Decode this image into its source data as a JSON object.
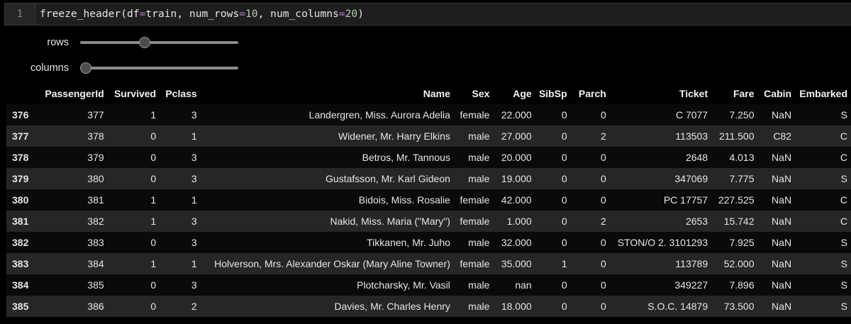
{
  "code_cell": {
    "line_number": "1",
    "func": "freeze_header(",
    "arg1_key": "df",
    "arg1_val": "train, ",
    "arg2_key": "num_rows",
    "arg2_val": "10",
    "arg3_key": "num_columns",
    "arg3_val": "20",
    "close": ")",
    "eq": "=",
    "comma": ", "
  },
  "widgets": {
    "rows": {
      "label": "rows",
      "level": 0.4
    },
    "columns": {
      "label": "columns",
      "level": 0.0
    }
  },
  "table": {
    "columns": [
      "",
      "PassengerId",
      "Survived",
      "Pclass",
      "Name",
      "Sex",
      "Age",
      "SibSp",
      "Parch",
      "Ticket",
      "Fare",
      "Cabin",
      "Embarked"
    ],
    "rows": [
      [
        "376",
        "377",
        "1",
        "3",
        "Landergren, Miss. Aurora Adelia",
        "female",
        "22.000",
        "0",
        "0",
        "C 7077",
        "7.250",
        "NaN",
        "S"
      ],
      [
        "377",
        "378",
        "0",
        "1",
        "Widener, Mr. Harry Elkins",
        "male",
        "27.000",
        "0",
        "2",
        "113503",
        "211.500",
        "C82",
        "C"
      ],
      [
        "378",
        "379",
        "0",
        "3",
        "Betros, Mr. Tannous",
        "male",
        "20.000",
        "0",
        "0",
        "2648",
        "4.013",
        "NaN",
        "C"
      ],
      [
        "379",
        "380",
        "0",
        "3",
        "Gustafsson, Mr. Karl Gideon",
        "male",
        "19.000",
        "0",
        "0",
        "347069",
        "7.775",
        "NaN",
        "S"
      ],
      [
        "380",
        "381",
        "1",
        "1",
        "Bidois, Miss. Rosalie",
        "female",
        "42.000",
        "0",
        "0",
        "PC 17757",
        "227.525",
        "NaN",
        "C"
      ],
      [
        "381",
        "382",
        "1",
        "3",
        "Nakid, Miss. Maria (\"Mary\")",
        "female",
        "1.000",
        "0",
        "2",
        "2653",
        "15.742",
        "NaN",
        "C"
      ],
      [
        "382",
        "383",
        "0",
        "3",
        "Tikkanen, Mr. Juho",
        "male",
        "32.000",
        "0",
        "0",
        "STON/O 2. 3101293",
        "7.925",
        "NaN",
        "S"
      ],
      [
        "383",
        "384",
        "1",
        "1",
        "Holverson, Mrs. Alexander Oskar (Mary Aline Towner)",
        "female",
        "35.000",
        "1",
        "0",
        "113789",
        "52.000",
        "NaN",
        "S"
      ],
      [
        "384",
        "385",
        "0",
        "3",
        "Plotcharsky, Mr. Vasil",
        "male",
        "nan",
        "0",
        "0",
        "349227",
        "7.896",
        "NaN",
        "S"
      ],
      [
        "385",
        "386",
        "0",
        "2",
        "Davies, Mr. Charles Henry",
        "male",
        "18.000",
        "0",
        "0",
        "S.O.C. 14879",
        "73.500",
        "NaN",
        "S"
      ]
    ]
  },
  "colors": {
    "background": "#000000",
    "row_alt": "#262626",
    "keyword_op": "#c678dd",
    "number": "#b5cea8"
  }
}
